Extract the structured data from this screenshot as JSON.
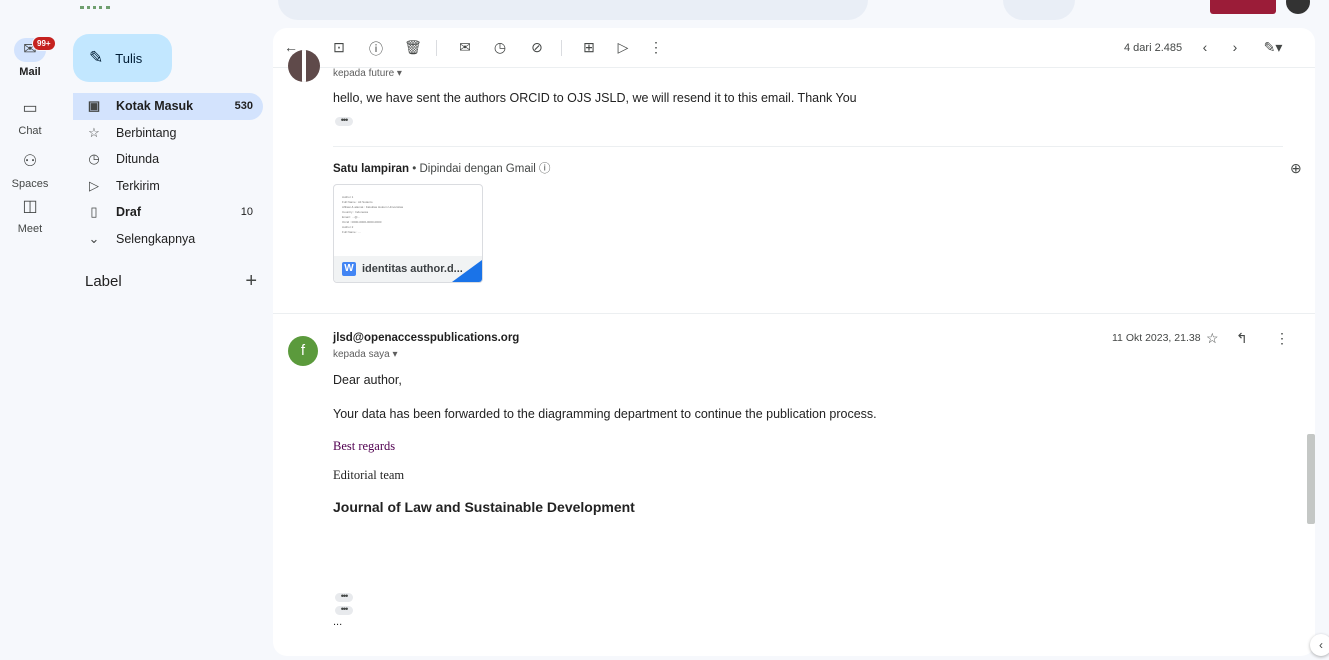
{
  "rail": {
    "badge": "99+",
    "items": [
      {
        "label": "Mail",
        "icon": "mail-icon"
      },
      {
        "label": "Chat",
        "icon": "chat-icon"
      },
      {
        "label": "Spaces",
        "icon": "spaces-icon"
      },
      {
        "label": "Meet",
        "icon": "meet-icon"
      }
    ]
  },
  "compose": {
    "label": "Tulis"
  },
  "nav": {
    "items": [
      {
        "label": "Kotak Masuk",
        "count": "530",
        "icon": "inbox-icon"
      },
      {
        "label": "Berbintang",
        "count": "",
        "icon": "star-icon"
      },
      {
        "label": "Ditunda",
        "count": "",
        "icon": "clock-icon"
      },
      {
        "label": "Terkirim",
        "count": "",
        "icon": "send-icon"
      },
      {
        "label": "Draf",
        "count": "10",
        "icon": "draft-icon"
      },
      {
        "label": "Selengkapnya",
        "count": "",
        "icon": "chevron-down-icon"
      }
    ],
    "label_section": "Label"
  },
  "toolbar": {
    "pager": "4 dari 2.485"
  },
  "message1": {
    "to_line": "kepada future ▾",
    "body": "hello, we have sent the authors ORCID to OJS JSLD, we will resend it to this email. Thank You",
    "attachment_count": "Satu lampiran",
    "scan_note": "• Dipindai dengan Gmail ⓘ",
    "attachment_name": "identitas author.d...",
    "attachment_preview": [
      "Author 1",
      "Full Name : Ali Sutanto",
      "Afiliasi & alamat : Fakultas Hukum Universitas",
      "Country : Indonesia",
      "Email : ...@...",
      "Orcid : 0000-0000-0000-0000",
      "Author 2",
      "Full Name : ..."
    ]
  },
  "message2": {
    "avatar_letter": "f",
    "sender": "jlsd@openaccesspublications.org",
    "to_line": "kepada saya ▾",
    "date": "11 Okt 2023, 21.38",
    "greeting": "Dear author,",
    "body": "Your data has been forwarded to the diagramming department to continue the publication process.",
    "regards": "Best regards",
    "team": "Editorial team",
    "journal": "Journal of Law and Sustainable Development",
    "trailing": "..."
  },
  "colors": {
    "accent": "#0b57d0",
    "compose_bg": "#c2e7ff",
    "active_nav": "#d3e3fd",
    "avatar_green": "#5b9a3c"
  }
}
